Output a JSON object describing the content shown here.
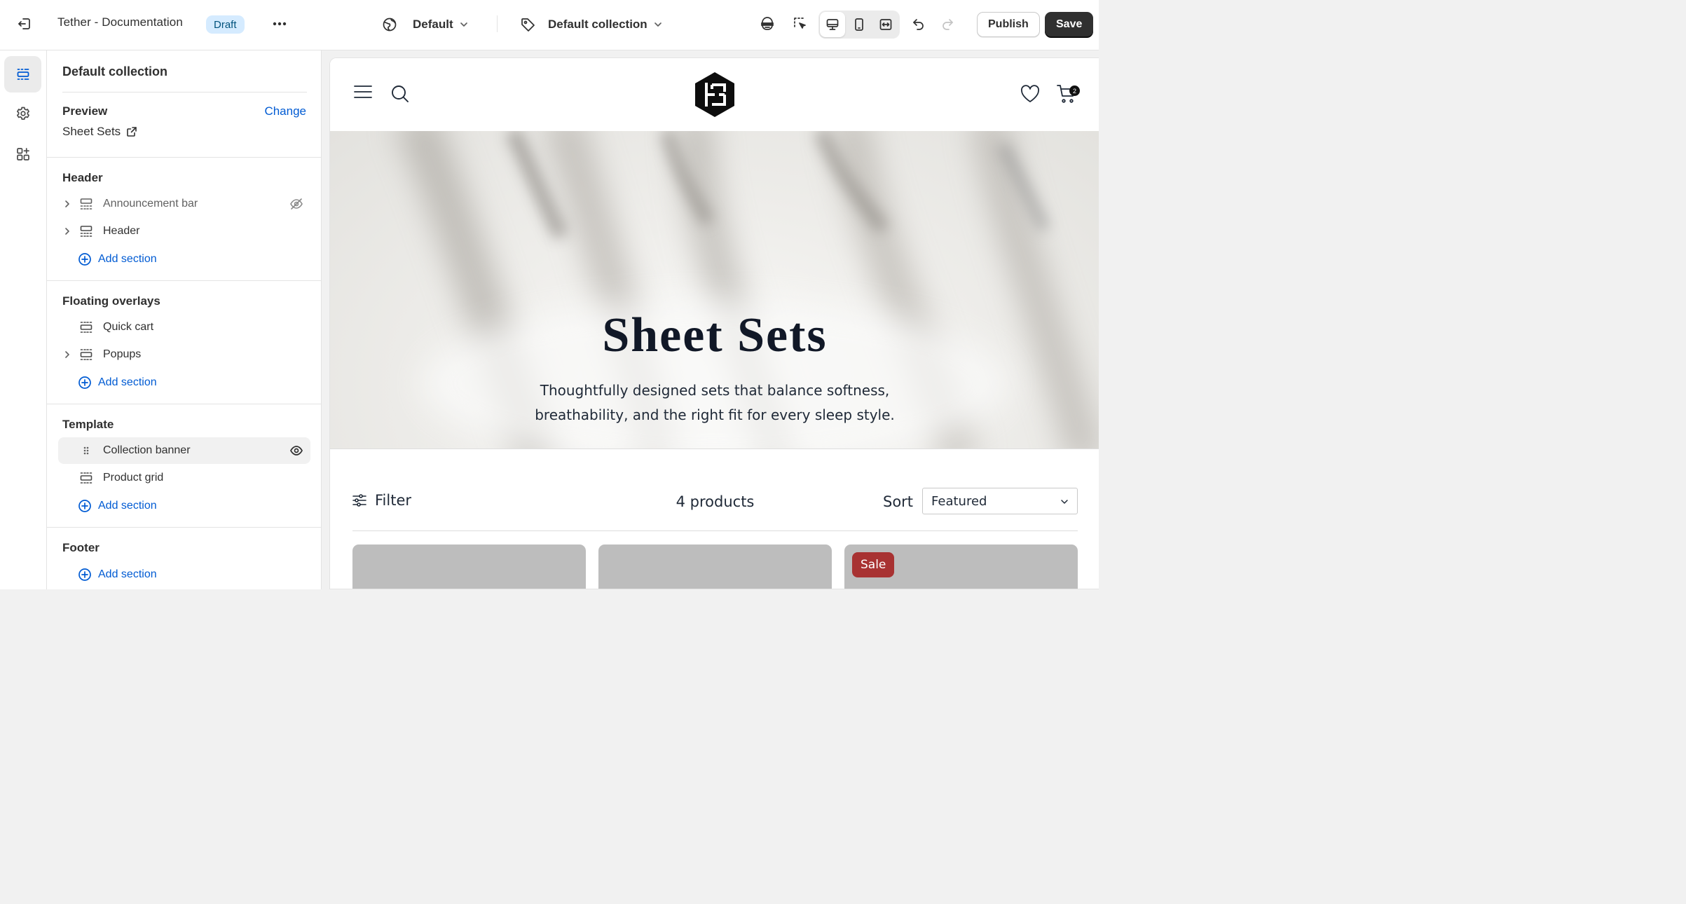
{
  "topbar": {
    "theme_name": "Tether - Documentation",
    "status_badge": "Draft",
    "template_select": "Default",
    "collection_select": "Default collection",
    "publish_label": "Publish",
    "save_label": "Save"
  },
  "sidebar": {
    "title": "Default collection",
    "preview_label": "Preview",
    "change_label": "Change",
    "preview_value": "Sheet Sets",
    "groups": {
      "header": {
        "title": "Header",
        "items": [
          {
            "label": "Announcement bar",
            "hidden": true
          },
          {
            "label": "Header",
            "hidden": false
          }
        ],
        "add_label": "Add section"
      },
      "overlays": {
        "title": "Floating overlays",
        "items": [
          {
            "label": "Quick cart"
          },
          {
            "label": "Popups"
          }
        ],
        "add_label": "Add section"
      },
      "template": {
        "title": "Template",
        "items": [
          {
            "label": "Collection banner",
            "selected": true
          },
          {
            "label": "Product grid"
          }
        ],
        "add_label": "Add section"
      },
      "footer": {
        "title": "Footer",
        "add_label": "Add section"
      }
    }
  },
  "storefront": {
    "cart_count": "2",
    "banner": {
      "title": "Sheet Sets",
      "subtitle_line1": "Thoughtfully designed sets that balance softness,",
      "subtitle_line2": "breathability, and the right fit for every sleep style."
    },
    "toolbar": {
      "filter_label": "Filter",
      "product_count": "4 products",
      "sort_label": "Sort",
      "sort_value": "Featured"
    },
    "cards": [
      {
        "badge": ""
      },
      {
        "badge": ""
      },
      {
        "badge": "Sale"
      }
    ]
  },
  "colors": {
    "accent_link": "#005bd3",
    "draft_badge_bg": "#d5ebff",
    "save_button_bg": "#303030",
    "sale_badge_bg": "#a83232"
  },
  "icons": {
    "exit": "exit-icon",
    "more": "ellipsis-icon",
    "template": "globe-icon",
    "collection": "tag-icon",
    "ai": "sidekick-icon",
    "inspect": "inspector-cursor-icon",
    "desktop": "desktop-icon",
    "mobile": "mobile-icon",
    "fullwidth": "fullscreen-icon",
    "undo": "undo-icon",
    "redo": "redo-icon"
  }
}
